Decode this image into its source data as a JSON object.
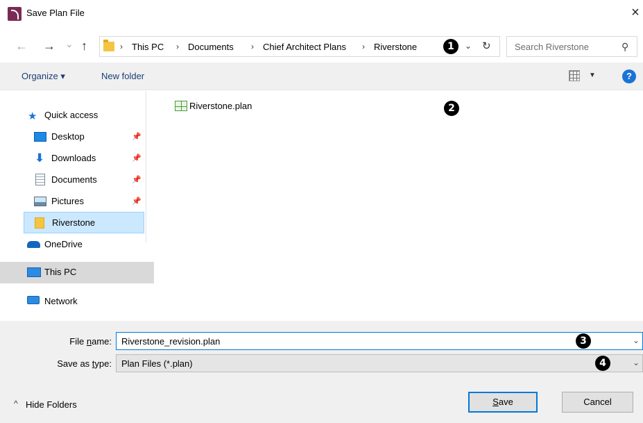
{
  "window": {
    "title": "Save Plan File",
    "close_glyph": "×"
  },
  "nav_buttons": {
    "back": "←",
    "forward": "→",
    "recent": "⌄",
    "up": "↑"
  },
  "address_bar": {
    "crumbs": [
      "This PC",
      "Documents",
      "Chief Architect Plans",
      "Riverstone"
    ],
    "separator": "›",
    "refresh_glyph": "↻",
    "dropdown_glyph": "⌄"
  },
  "search": {
    "placeholder": "Search Riverstone",
    "icon_glyph": "⚲"
  },
  "toolbar": {
    "organize_label": "Organize ▾",
    "new_folder_label": "New folder",
    "view_caret": "▼",
    "help_glyph": "?"
  },
  "sidebar": {
    "quick_access": "Quick access",
    "items": [
      {
        "label": "Desktop",
        "pinned": true
      },
      {
        "label": "Downloads",
        "pinned": true
      },
      {
        "label": "Documents",
        "pinned": true
      },
      {
        "label": "Pictures",
        "pinned": true
      },
      {
        "label": "Riverstone",
        "pinned": false,
        "selected": true
      }
    ],
    "onedrive": "OneDrive",
    "this_pc": "This PC",
    "network": "Network",
    "pin_glyph": "📌"
  },
  "files": [
    {
      "name": "Riverstone.plan",
      "icon": "plan-file-icon"
    }
  ],
  "markers": [
    "1",
    "2",
    "3",
    "4"
  ],
  "form": {
    "file_name_label_pre": "File ",
    "file_name_label_u": "n",
    "file_name_label_post": "ame:",
    "file_name_value": "Riverstone_revision.plan",
    "save_type_label_pre": "Save as ",
    "save_type_label_u": "t",
    "save_type_label_post": "ype:",
    "save_type_value": "Plan Files (*.plan)"
  },
  "footer": {
    "hide_folders": "Hide Folders",
    "hide_folders_glyph": "^",
    "save_label_u": "S",
    "save_label_rest": "ave",
    "cancel_label": "Cancel"
  },
  "colors": {
    "accent": "#0078d7",
    "app_icon": "#7a2a55",
    "selection": "#cce8ff",
    "folder": "#f5c542"
  }
}
